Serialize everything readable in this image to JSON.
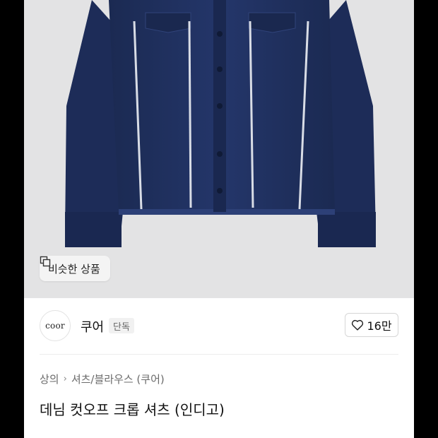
{
  "similar_button": {
    "label": "비슷한 상품",
    "icon": "similar-items-icon"
  },
  "brand": {
    "logo_text": "coor",
    "name": "쿠어",
    "badge": "단독"
  },
  "like": {
    "icon": "heart-icon",
    "count": "16만"
  },
  "breadcrumb": {
    "items": [
      "상의",
      "셔츠/블라우스 (쿠어)"
    ],
    "separator_icon": "chevron-right-icon"
  },
  "product": {
    "title": "데님 컷오프 크롭 셔츠 (인디고)"
  },
  "colors": {
    "denim": "#1f2f5c",
    "photo_bg": "#e3e3e4"
  }
}
